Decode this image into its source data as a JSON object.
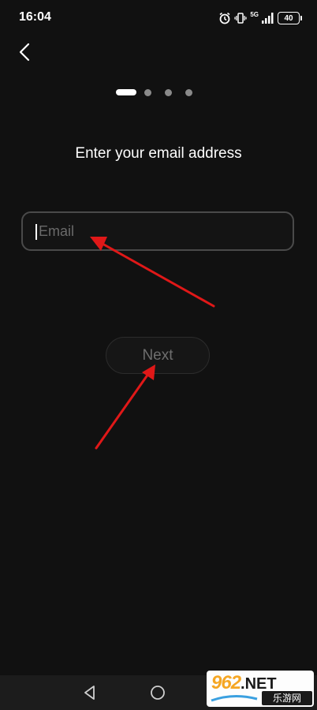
{
  "status_bar": {
    "time": "16:04",
    "signal_label": "5G",
    "battery": "40",
    "icons": [
      "alarm-icon",
      "vibrate-icon",
      "signal-icon",
      "battery-icon"
    ]
  },
  "header": {
    "back_icon": "chevron-left-icon"
  },
  "steps": {
    "total": 4,
    "current": 1
  },
  "title": "Enter your email address",
  "email_field": {
    "placeholder": "Email",
    "value": ""
  },
  "next_button": {
    "label": "Next"
  },
  "annotations": {
    "arrow_color": "#e01818"
  },
  "nav_bar": {
    "icons": [
      "nav-back-icon",
      "nav-home-icon"
    ]
  },
  "watermark": {
    "brand": "962",
    "suffix": ".NET",
    "subtitle": "乐游网"
  },
  "colors": {
    "background": "#111111",
    "text": "#ffffff",
    "muted_text": "#6e6e6e",
    "field_border": "#4a4a4a"
  }
}
